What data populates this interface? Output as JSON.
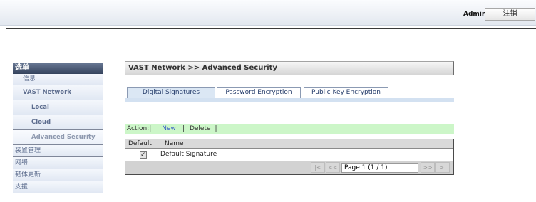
{
  "header": {
    "user_label": "Admin",
    "logout_label": "注销"
  },
  "sidebar": {
    "title": "选单",
    "items": [
      {
        "label": "信息"
      },
      {
        "label": "VAST Network"
      },
      {
        "label": "Local"
      },
      {
        "label": "Cloud"
      },
      {
        "label": "Advanced Security",
        "selected": true
      },
      {
        "label": "装置管理"
      },
      {
        "label": "网络"
      },
      {
        "label": "韧体更新"
      },
      {
        "label": "支援"
      }
    ]
  },
  "main": {
    "title": "VAST Network >> Advanced Security",
    "tabs": [
      {
        "label": "Digital Signatures",
        "active": true
      },
      {
        "label": "Password Encryption",
        "active": false
      },
      {
        "label": "Public Key Encryption",
        "active": false
      }
    ],
    "action_bar": {
      "prefix": "Action:|",
      "new_label": "New",
      "separator_1": "|",
      "delete_label": "Delete",
      "separator_2": "|"
    },
    "table": {
      "columns": [
        "Default",
        "Name"
      ],
      "rows": [
        {
          "default": true,
          "name": "Default Signature"
        }
      ],
      "pager": {
        "first": "|<",
        "prev": "<<",
        "page": "Page 1 (1 / 1)",
        "next": ">>",
        "last": ">|"
      }
    }
  },
  "colors": {
    "link": "#3a5fc4",
    "action_bar_bg": "#ccf6c8",
    "tab_active_bg": "#dbe7f4",
    "sidebar_header_bg": "#34425c"
  }
}
